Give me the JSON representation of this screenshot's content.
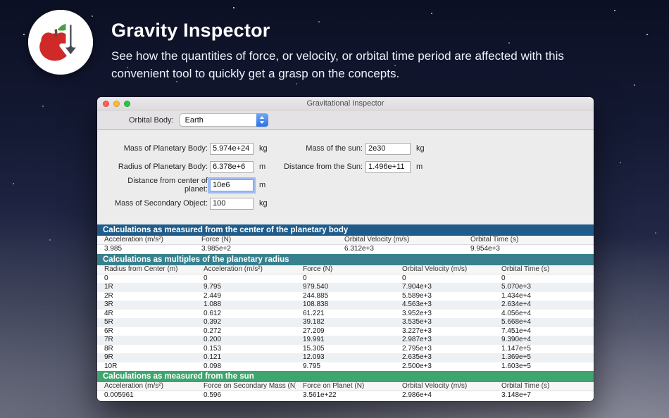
{
  "hero": {
    "title": "Gravity Inspector",
    "subtitle_line1": "See how the quantities of force, or velocity, or orbital time period are affected with this",
    "subtitle_line2": "convenient tool to quickly get a grasp on the concepts."
  },
  "colors": {
    "section_center_header": "#1f5c8b",
    "section_radius_header": "#38808e",
    "section_sun_header": "#3ea56e",
    "popup_accent": "#2e6fe2",
    "focus_ring": "#6ea3f0"
  },
  "window": {
    "title": "Gravitational Inspector",
    "toolbar": {
      "orbital_body_label": "Orbital Body:",
      "orbital_body_value": "Earth"
    },
    "form": {
      "left": [
        {
          "label": "Mass of Planetary Body:",
          "value": "5.974e+24",
          "unit": "kg"
        },
        {
          "label": "Radius of Planetary Body:",
          "value": "6.378e+6",
          "unit": "m"
        },
        {
          "label": "Distance from center of planet:",
          "value": "10e6",
          "unit": "m"
        },
        {
          "label": "Mass of Secondary Object:",
          "value": "100",
          "unit": "kg"
        }
      ],
      "right": [
        {
          "label": "Mass of the sun:",
          "value": "2e30",
          "unit": "kg"
        },
        {
          "label": "Distance from the Sun:",
          "value": "1.496e+11",
          "unit": "m"
        }
      ]
    },
    "section_center": {
      "header": "Calculations as measured from the center of the planetary body",
      "columns": [
        "Acceleration (m/s²)",
        "Force (N)",
        "Orbital Velocity (m/s)",
        "Orbital Time (s)"
      ],
      "rows": [
        [
          "3.985",
          "3.985e+2",
          "6.312e+3",
          "9.954e+3"
        ]
      ]
    },
    "section_radius": {
      "header": "Calculations as multiples of the planetary radius",
      "columns": [
        "Radius from Center (m)",
        "Acceleration (m/s²)",
        "Force (N)",
        "Orbital Velocity (m/s)",
        "Orbital Time (s)"
      ],
      "rows": [
        [
          "0",
          "0",
          "0",
          "0",
          "0"
        ],
        [
          "1R",
          "9.795",
          "979.540",
          "7.904e+3",
          "5.070e+3"
        ],
        [
          "2R",
          "2.449",
          "244.885",
          "5.589e+3",
          "1.434e+4"
        ],
        [
          "3R",
          "1.088",
          "108.838",
          "4.563e+3",
          "2.634e+4"
        ],
        [
          "4R",
          "0.612",
          "61.221",
          "3.952e+3",
          "4.056e+4"
        ],
        [
          "5R",
          "0.392",
          "39.182",
          "3.535e+3",
          "5.668e+4"
        ],
        [
          "6R",
          "0.272",
          "27.209",
          "3.227e+3",
          "7.451e+4"
        ],
        [
          "7R",
          "0.200",
          "19.991",
          "2.987e+3",
          "9.390e+4"
        ],
        [
          "8R",
          "0.153",
          "15.305",
          "2.795e+3",
          "1.147e+5"
        ],
        [
          "9R",
          "0.121",
          "12.093",
          "2.635e+3",
          "1.369e+5"
        ],
        [
          "10R",
          "0.098",
          "9.795",
          "2.500e+3",
          "1.603e+5"
        ]
      ]
    },
    "section_sun": {
      "header": "Calculations as measured from the sun",
      "columns": [
        "Acceleration (m/s²)",
        "Force on Secondary Mass (N)",
        "Force on Planet (N)",
        "Orbital Velocity (m/s)",
        "Orbital Time (s)"
      ],
      "rows": [
        [
          "0.005961",
          "0.596",
          "3.561e+22",
          "2.986e+4",
          "3.148e+7"
        ]
      ]
    }
  }
}
